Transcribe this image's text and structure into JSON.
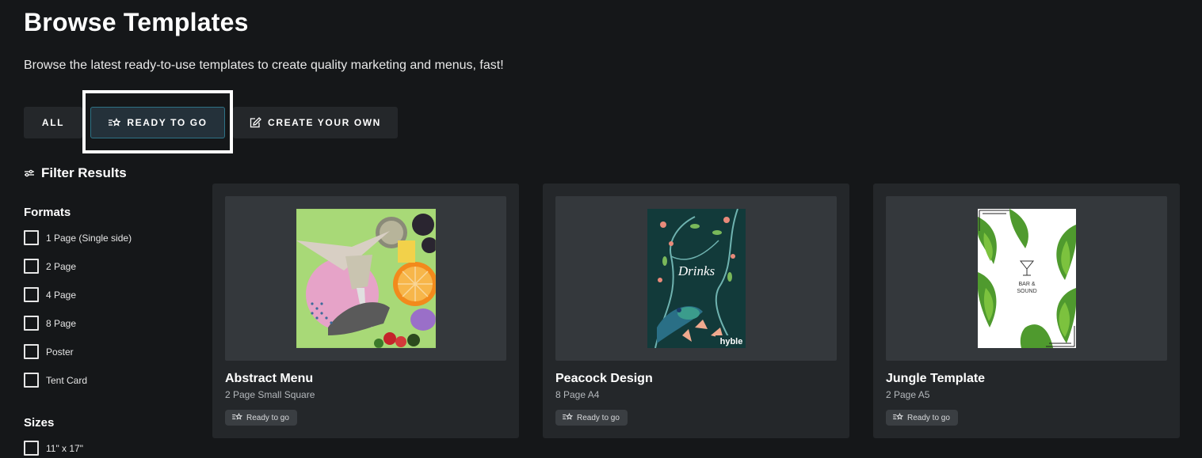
{
  "page": {
    "title": "Browse Templates",
    "subtitle": "Browse the latest ready-to-use templates to create quality marketing and menus, fast!"
  },
  "tabs": [
    {
      "label": "ALL",
      "icon": null
    },
    {
      "label": "READY TO GO",
      "icon": "ready-to-go-icon",
      "active": true
    },
    {
      "label": "CREATE YOUR OWN",
      "icon": "edit-icon"
    }
  ],
  "filters": {
    "heading": "Filter Results",
    "formats": {
      "heading": "Formats",
      "options": [
        "1 Page (Single side)",
        "2 Page",
        "4 Page",
        "8 Page",
        "Poster",
        "Tent Card"
      ]
    },
    "sizes": {
      "heading": "Sizes",
      "options": [
        "11\" x 17\""
      ]
    }
  },
  "templates": [
    {
      "title": "Abstract Menu",
      "subtitle": "2 Page Small Square",
      "badge": "Ready to go"
    },
    {
      "title": "Peacock Design",
      "subtitle": "8 Page A4",
      "badge": "Ready to go",
      "thumb_text": "Drinks",
      "brand": "hyble"
    },
    {
      "title": "Jungle Template",
      "subtitle": "2 Page A5",
      "badge": "Ready to go",
      "thumb_text_1": "BAR &",
      "thumb_text_2": "SOUND"
    }
  ],
  "colors": {
    "background": "#151719",
    "panel": "#24272a",
    "active_tab_border": "#2e7386",
    "highlight": "#ffffff"
  }
}
